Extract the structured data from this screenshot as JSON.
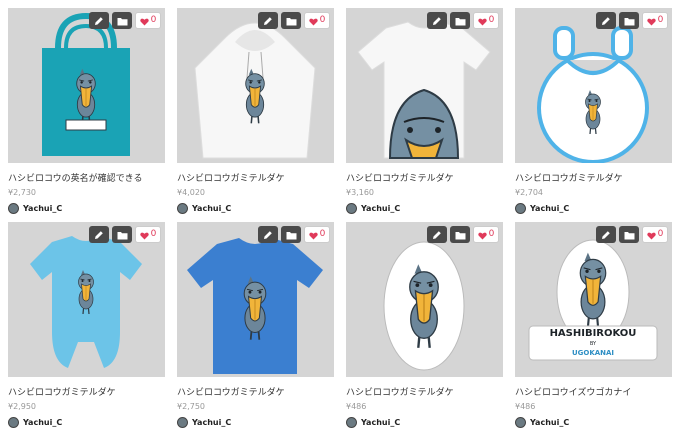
{
  "products": [
    {
      "title": "ハシビロコウの英名が確認できる",
      "price": "¥2,730",
      "user": "Yachui_C",
      "likes": "0",
      "kind": "tote",
      "color": "#1aa3b5"
    },
    {
      "title": "ハシビロコウガミテルダケ",
      "price": "¥4,020",
      "user": "Yachui_C",
      "likes": "0",
      "kind": "hoodie",
      "color": "#f7f7f7"
    },
    {
      "title": "ハシビロコウガミテルダケ",
      "price": "¥3,160",
      "user": "Yachui_C",
      "likes": "0",
      "kind": "tee-peek",
      "color": "#f7f7f7"
    },
    {
      "title": "ハシビロコウガミテルダケ",
      "price": "¥2,704",
      "user": "Yachui_C",
      "likes": "0",
      "kind": "bib",
      "color": "#ffffff"
    },
    {
      "title": "ハシビロコウガミテルダケ",
      "price": "¥2,950",
      "user": "Yachui_C",
      "likes": "0",
      "kind": "romper",
      "color": "#6cc4e8"
    },
    {
      "title": "ハシビロコウガミテルダケ",
      "price": "¥2,750",
      "user": "Yachui_C",
      "likes": "0",
      "kind": "tee",
      "color": "#3b7fd0"
    },
    {
      "title": "ハシビロコウガミテルダケ",
      "price": "¥486",
      "user": "Yachui_C",
      "likes": "0",
      "kind": "sticker",
      "color": "#ffffff"
    },
    {
      "title": "ハシビロコウイズウゴカナイ",
      "price": "¥486",
      "user": "Yachui_C",
      "likes": "0",
      "kind": "sticker-text",
      "color": "#ffffff",
      "line1": "HASHIBIROKOU",
      "line2": "BY",
      "line3": "UGOKANAI"
    }
  ]
}
